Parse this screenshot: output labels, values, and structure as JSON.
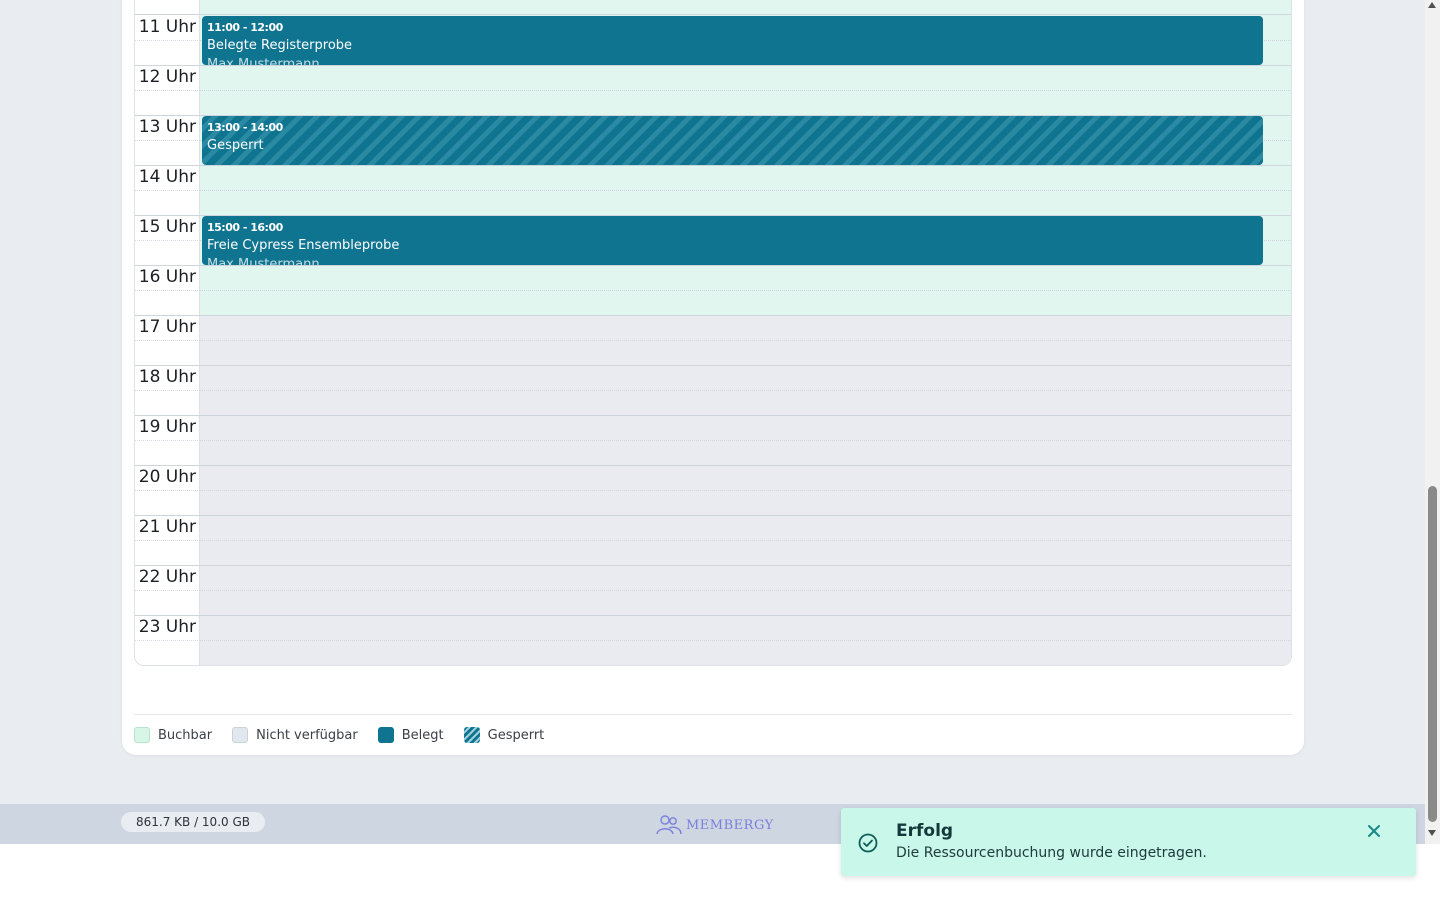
{
  "calendar": {
    "hours": [
      "11 Uhr",
      "12 Uhr",
      "13 Uhr",
      "14 Uhr",
      "15 Uhr",
      "16 Uhr",
      "17 Uhr",
      "18 Uhr",
      "19 Uhr",
      "20 Uhr",
      "21 Uhr",
      "22 Uhr",
      "23 Uhr"
    ],
    "events": [
      {
        "time": "11:00 - 12:00",
        "title": "Belegte Registerprobe",
        "person": "Max Mustermann",
        "status": "Belegt"
      },
      {
        "time": "13:00 - 14:00",
        "title": "Gesperrt",
        "status": "Gesperrt"
      },
      {
        "time": "15:00 - 16:00",
        "title": "Freie Cypress Ensembleprobe",
        "person": "Max Mustermann",
        "status": "Belegt"
      }
    ]
  },
  "legend": {
    "bookable": "Buchbar",
    "unavailable": "Nicht verfügbar",
    "occupied": "Belegt",
    "blocked": "Gesperrt"
  },
  "footer": {
    "storage": "861.7 KB / 10.0 GB",
    "brand": "MEMBERGY"
  },
  "toast": {
    "title": "Erfolg",
    "message": "Die Ressourcenbuchung wurde eingetragen."
  },
  "colors": {
    "bookable": "#e0f6ee",
    "unavailable": "#e9ebf0",
    "occupied": "#0f7490",
    "toast": "#c9f7ea",
    "footer": "#cdd6e1"
  }
}
